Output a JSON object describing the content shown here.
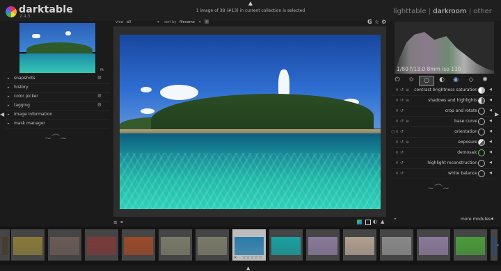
{
  "app": {
    "name": "darktable",
    "version": "2.4.3"
  },
  "header": {
    "collection_info": "1 image of 38 (#13) in current collection is selected",
    "views": [
      "lighttable",
      "darkroom",
      "other"
    ],
    "active_view": "darkroom",
    "separator": "|"
  },
  "left_panel": {
    "zoom_label": "fit",
    "modules": [
      {
        "label": "snapshots",
        "has_gear": true
      },
      {
        "label": "history",
        "has_gear": false
      },
      {
        "label": "color picker",
        "has_gear": true
      },
      {
        "label": "tagging",
        "has_gear": true
      },
      {
        "label": "image information",
        "has_gear": false
      },
      {
        "label": "mask manager",
        "has_gear": false
      }
    ]
  },
  "center_header": {
    "view_label": "view",
    "view_value": "all",
    "sort_label": "sort by",
    "sort_value": "filename"
  },
  "histogram": {
    "exif": "1/80 f/13.0 8mm iso 110"
  },
  "right_panel": {
    "group_icons": [
      "power-icon",
      "star-icon",
      "circle-icon",
      "contrast-icon",
      "color-icon",
      "drop-icon",
      "sun-icon"
    ],
    "active_group": "circle-icon",
    "modules": [
      {
        "label": "contrast brightness saturation",
        "icon": "palette-icon"
      },
      {
        "label": "shadows and highlights",
        "icon": "shadows-icon"
      },
      {
        "label": "crop and rotate",
        "icon": "crop-icon"
      },
      {
        "label": "base curve",
        "icon": "curve-icon"
      },
      {
        "label": "orientation",
        "icon": "orientation-icon"
      },
      {
        "label": "exposure",
        "icon": "exposure-icon"
      },
      {
        "label": "demosaic",
        "icon": "demosaic-icon"
      },
      {
        "label": "highlight reconstruction",
        "icon": "highlight-icon"
      },
      {
        "label": "white balance",
        "icon": "wb-icon"
      }
    ],
    "more_modules": "more modules"
  },
  "filmstrip": {
    "selected_index": 6,
    "thumbs": [
      {
        "color": "#4a3a2a"
      },
      {
        "color": "#8a7a3a"
      },
      {
        "color": "#6a5a55"
      },
      {
        "color": "#7a3a3a"
      },
      {
        "color": "#9a4a2a"
      },
      {
        "color": "#7a7a6a"
      },
      {
        "color": "#2a7aa8"
      },
      {
        "color": "#1aa0a0"
      },
      {
        "color": "#8a7a9a"
      },
      {
        "color": "#b0a090"
      },
      {
        "color": "#8a8a8a"
      },
      {
        "color": "#8a7a9a"
      },
      {
        "color": "#4a9a3a"
      },
      {
        "color": "#2a4a6a"
      }
    ]
  }
}
